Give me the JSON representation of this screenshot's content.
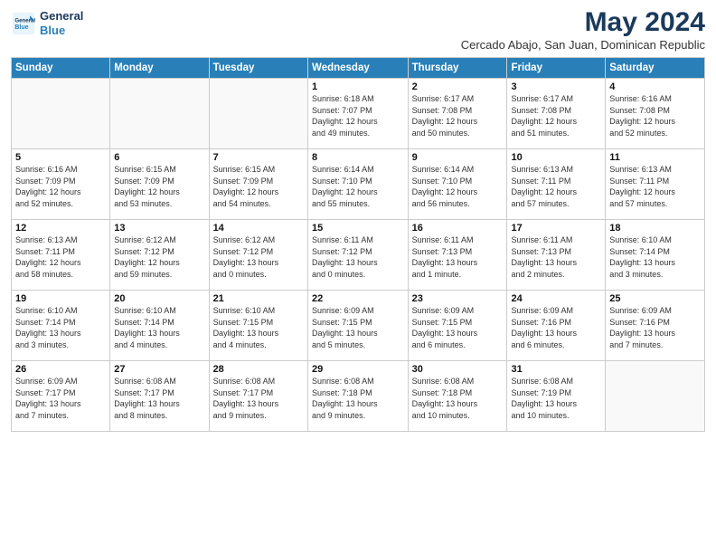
{
  "header": {
    "logo_line1": "General",
    "logo_line2": "Blue",
    "month_title": "May 2024",
    "subtitle": "Cercado Abajo, San Juan, Dominican Republic"
  },
  "weekdays": [
    "Sunday",
    "Monday",
    "Tuesday",
    "Wednesday",
    "Thursday",
    "Friday",
    "Saturday"
  ],
  "weeks": [
    [
      {
        "day": "",
        "info": ""
      },
      {
        "day": "",
        "info": ""
      },
      {
        "day": "",
        "info": ""
      },
      {
        "day": "1",
        "info": "Sunrise: 6:18 AM\nSunset: 7:07 PM\nDaylight: 12 hours\nand 49 minutes."
      },
      {
        "day": "2",
        "info": "Sunrise: 6:17 AM\nSunset: 7:08 PM\nDaylight: 12 hours\nand 50 minutes."
      },
      {
        "day": "3",
        "info": "Sunrise: 6:17 AM\nSunset: 7:08 PM\nDaylight: 12 hours\nand 51 minutes."
      },
      {
        "day": "4",
        "info": "Sunrise: 6:16 AM\nSunset: 7:08 PM\nDaylight: 12 hours\nand 52 minutes."
      }
    ],
    [
      {
        "day": "5",
        "info": "Sunrise: 6:16 AM\nSunset: 7:09 PM\nDaylight: 12 hours\nand 52 minutes."
      },
      {
        "day": "6",
        "info": "Sunrise: 6:15 AM\nSunset: 7:09 PM\nDaylight: 12 hours\nand 53 minutes."
      },
      {
        "day": "7",
        "info": "Sunrise: 6:15 AM\nSunset: 7:09 PM\nDaylight: 12 hours\nand 54 minutes."
      },
      {
        "day": "8",
        "info": "Sunrise: 6:14 AM\nSunset: 7:10 PM\nDaylight: 12 hours\nand 55 minutes."
      },
      {
        "day": "9",
        "info": "Sunrise: 6:14 AM\nSunset: 7:10 PM\nDaylight: 12 hours\nand 56 minutes."
      },
      {
        "day": "10",
        "info": "Sunrise: 6:13 AM\nSunset: 7:11 PM\nDaylight: 12 hours\nand 57 minutes."
      },
      {
        "day": "11",
        "info": "Sunrise: 6:13 AM\nSunset: 7:11 PM\nDaylight: 12 hours\nand 57 minutes."
      }
    ],
    [
      {
        "day": "12",
        "info": "Sunrise: 6:13 AM\nSunset: 7:11 PM\nDaylight: 12 hours\nand 58 minutes."
      },
      {
        "day": "13",
        "info": "Sunrise: 6:12 AM\nSunset: 7:12 PM\nDaylight: 12 hours\nand 59 minutes."
      },
      {
        "day": "14",
        "info": "Sunrise: 6:12 AM\nSunset: 7:12 PM\nDaylight: 13 hours\nand 0 minutes."
      },
      {
        "day": "15",
        "info": "Sunrise: 6:11 AM\nSunset: 7:12 PM\nDaylight: 13 hours\nand 0 minutes."
      },
      {
        "day": "16",
        "info": "Sunrise: 6:11 AM\nSunset: 7:13 PM\nDaylight: 13 hours\nand 1 minute."
      },
      {
        "day": "17",
        "info": "Sunrise: 6:11 AM\nSunset: 7:13 PM\nDaylight: 13 hours\nand 2 minutes."
      },
      {
        "day": "18",
        "info": "Sunrise: 6:10 AM\nSunset: 7:14 PM\nDaylight: 13 hours\nand 3 minutes."
      }
    ],
    [
      {
        "day": "19",
        "info": "Sunrise: 6:10 AM\nSunset: 7:14 PM\nDaylight: 13 hours\nand 3 minutes."
      },
      {
        "day": "20",
        "info": "Sunrise: 6:10 AM\nSunset: 7:14 PM\nDaylight: 13 hours\nand 4 minutes."
      },
      {
        "day": "21",
        "info": "Sunrise: 6:10 AM\nSunset: 7:15 PM\nDaylight: 13 hours\nand 4 minutes."
      },
      {
        "day": "22",
        "info": "Sunrise: 6:09 AM\nSunset: 7:15 PM\nDaylight: 13 hours\nand 5 minutes."
      },
      {
        "day": "23",
        "info": "Sunrise: 6:09 AM\nSunset: 7:15 PM\nDaylight: 13 hours\nand 6 minutes."
      },
      {
        "day": "24",
        "info": "Sunrise: 6:09 AM\nSunset: 7:16 PM\nDaylight: 13 hours\nand 6 minutes."
      },
      {
        "day": "25",
        "info": "Sunrise: 6:09 AM\nSunset: 7:16 PM\nDaylight: 13 hours\nand 7 minutes."
      }
    ],
    [
      {
        "day": "26",
        "info": "Sunrise: 6:09 AM\nSunset: 7:17 PM\nDaylight: 13 hours\nand 7 minutes."
      },
      {
        "day": "27",
        "info": "Sunrise: 6:08 AM\nSunset: 7:17 PM\nDaylight: 13 hours\nand 8 minutes."
      },
      {
        "day": "28",
        "info": "Sunrise: 6:08 AM\nSunset: 7:17 PM\nDaylight: 13 hours\nand 9 minutes."
      },
      {
        "day": "29",
        "info": "Sunrise: 6:08 AM\nSunset: 7:18 PM\nDaylight: 13 hours\nand 9 minutes."
      },
      {
        "day": "30",
        "info": "Sunrise: 6:08 AM\nSunset: 7:18 PM\nDaylight: 13 hours\nand 10 minutes."
      },
      {
        "day": "31",
        "info": "Sunrise: 6:08 AM\nSunset: 7:19 PM\nDaylight: 13 hours\nand 10 minutes."
      },
      {
        "day": "",
        "info": ""
      }
    ]
  ]
}
